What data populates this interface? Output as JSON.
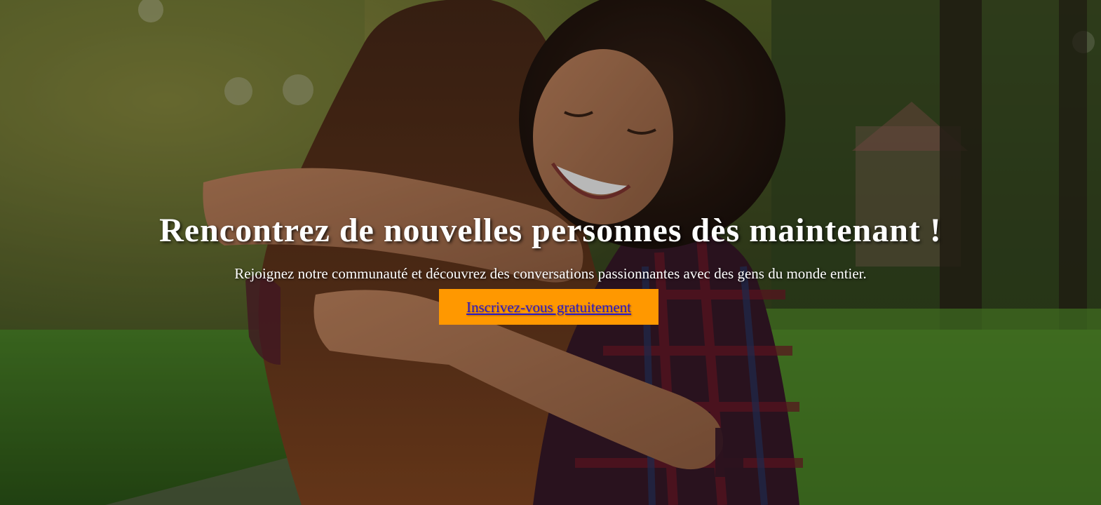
{
  "hero": {
    "title": "Rencontrez de nouvelles personnes dès maintenant !",
    "subtitle": "Rejoignez notre communauté et découvrez des conversations passionnantes avec des gens du monde entier.",
    "cta_label": "Inscrivez-vous gratuitement",
    "background_image": "two-women-hugging-in-park-photo"
  },
  "colors": {
    "cta_background": "#ff9800",
    "cta_text": "#2a17c9",
    "title_text": "#ffffff"
  }
}
